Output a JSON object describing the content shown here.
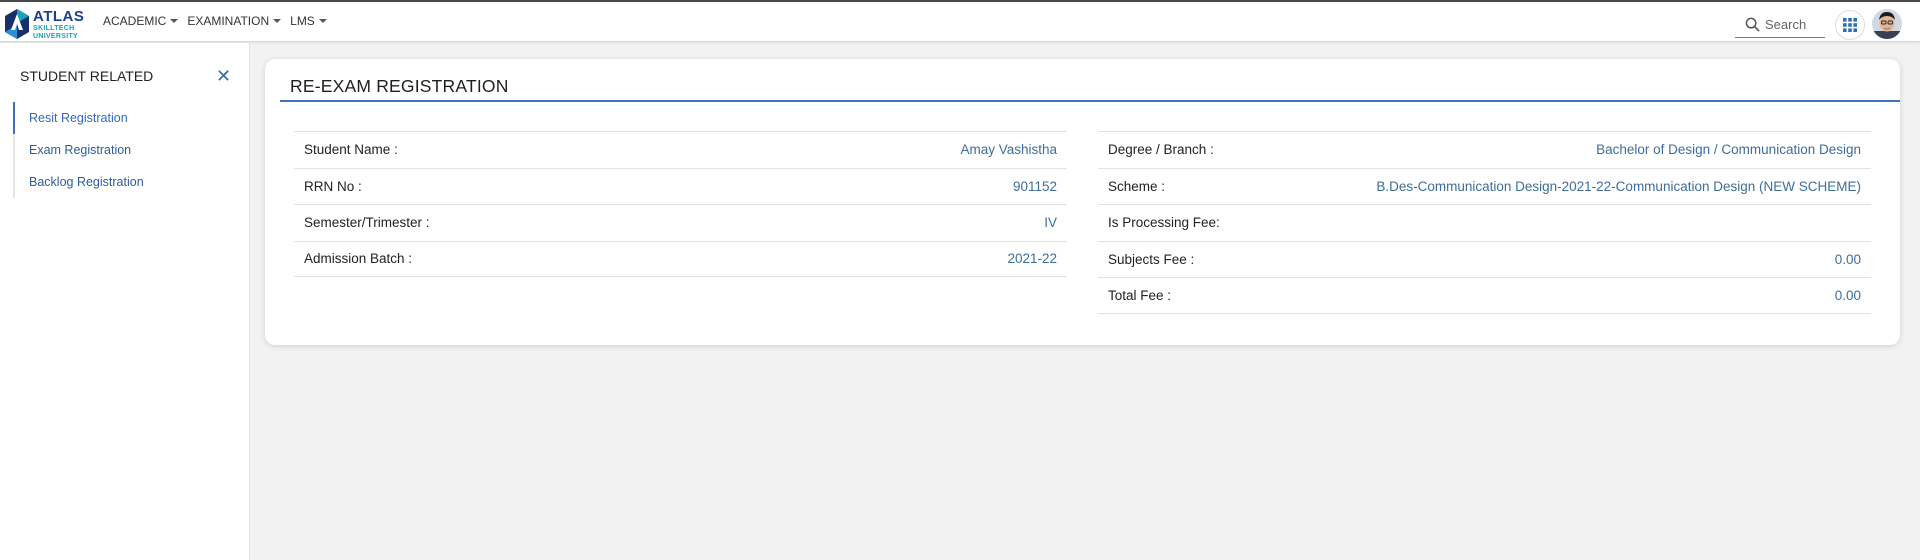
{
  "brand": {
    "name": "ATLAS",
    "subtitle_line1": "SKILLTECH",
    "subtitle_line2": "UNIVERSITY"
  },
  "nav": {
    "items": [
      {
        "label": "ACADEMIC"
      },
      {
        "label": "EXAMINATION"
      },
      {
        "label": "LMS"
      }
    ]
  },
  "search": {
    "placeholder": "Search"
  },
  "icons": {
    "search": "search-icon",
    "apps": "grid-apps-icon",
    "close": "close-icon",
    "caret": "chevron-down-icon"
  },
  "sidebar": {
    "title": "STUDENT RELATED",
    "close_glyph": "✕",
    "items": [
      {
        "label": "Resit Registration",
        "active": true
      },
      {
        "label": "Exam Registration",
        "active": false
      },
      {
        "label": "Backlog Registration",
        "active": false
      }
    ]
  },
  "card": {
    "title": "RE-EXAM REGISTRATION",
    "left": [
      {
        "label": "Student Name :",
        "value": "Amay Vashistha"
      },
      {
        "label": "RRN No :",
        "value": "901152"
      },
      {
        "label": "Semester/Trimester :",
        "value": "IV"
      },
      {
        "label": "Admission Batch :",
        "value": "2021-22"
      }
    ],
    "right": [
      {
        "label": "Degree / Branch :",
        "value": "Bachelor of Design / Communication Design"
      },
      {
        "label": "Scheme :",
        "value": "B.Des-Communication Design-2021-22-Communication Design (NEW SCHEME)"
      },
      {
        "label": "Is Processing Fee:",
        "value": ""
      },
      {
        "label": "Subjects Fee :",
        "value": "0.00"
      },
      {
        "label": "Total Fee :",
        "value": "0.00"
      }
    ]
  },
  "colors": {
    "accent": "#3c72be",
    "link": "#2d5d9a",
    "value_text": "#3d6d9c",
    "background": "#f2f2f2"
  }
}
